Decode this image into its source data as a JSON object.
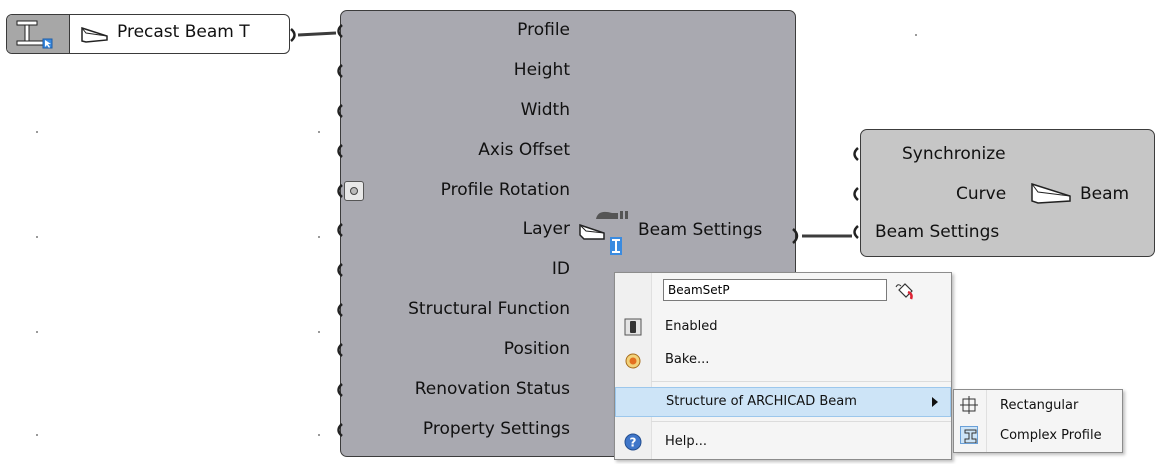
{
  "source_param": {
    "label": "Precast Beam T"
  },
  "main_component": {
    "inputs": [
      "Profile",
      "Height",
      "Width",
      "Axis Offset",
      "Profile Rotation",
      "Layer",
      "ID",
      "Structural Function",
      "Position",
      "Renovation Status",
      "Property Settings"
    ],
    "output": "Beam Settings"
  },
  "beam_component": {
    "inputs": [
      "Synchronize",
      "Curve",
      "Beam Settings"
    ],
    "output": "Beam"
  },
  "context_menu": {
    "name_value": "BeamSetP",
    "items": {
      "enabled": "Enabled",
      "bake": "Bake...",
      "structure": "Structure of ARCHICAD Beam",
      "help": "Help..."
    },
    "submenu": {
      "rectangular": "Rectangular",
      "complex_profile": "Complex Profile"
    }
  },
  "colors": {
    "component_fill": "#a9a9b0",
    "beam_component_fill": "#c6c6c6",
    "wire": "#3c3c3c",
    "menu_highlight": "#cde4f7"
  }
}
